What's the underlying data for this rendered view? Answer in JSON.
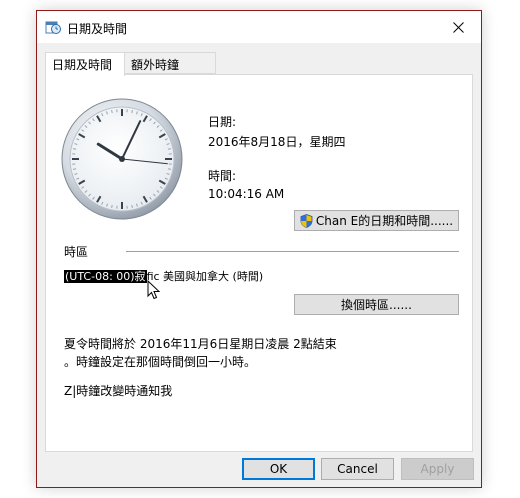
{
  "window": {
    "title": "日期及時間"
  },
  "tabs": [
    {
      "label": "日期及時間"
    },
    {
      "label": "額外時鐘"
    }
  ],
  "clock": {
    "hour": 10,
    "minute": 4,
    "second": 16
  },
  "date": {
    "label": "日期:",
    "value": "2016年8月18日，星期四"
  },
  "time": {
    "label": "時間:",
    "value": "10:04:16 AM"
  },
  "change_datetime_button": "Chan E的日期和時間......",
  "timezone": {
    "label": "時區",
    "value_highlighted": "(UTC-08: 00)寂",
    "value_rest": "fic 美國與加拿大 (時間)",
    "change_button": "換個時區......"
  },
  "dst_info": {
    "line1": "夏令時間將於 2016年11月6日星期日凌晨 2點結束",
    "line2": "。時鐘設定在那個時間倒回一小時。"
  },
  "notify_text": "Z|時鐘改變時通知我",
  "buttons": {
    "ok": "OK",
    "cancel": "Cancel",
    "apply": "Apply"
  }
}
